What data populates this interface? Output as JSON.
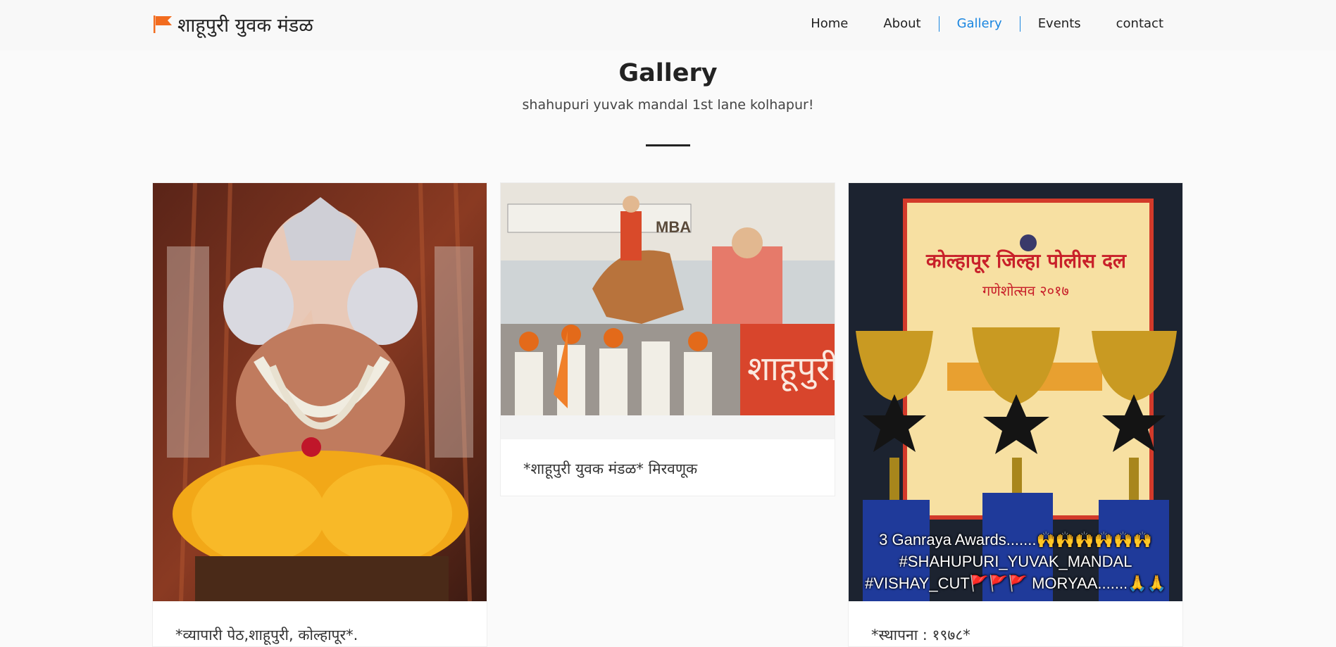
{
  "brand": {
    "title": "शाहूपुरी युवक मंडळ",
    "flag_color": "#f26c1f"
  },
  "nav": {
    "items": [
      {
        "label": "Home",
        "active": false
      },
      {
        "label": "About",
        "active": false
      },
      {
        "label": "Gallery",
        "active": true
      },
      {
        "label": "Events",
        "active": false
      },
      {
        "label": "contact",
        "active": false
      }
    ],
    "active_color": "#1a86e0"
  },
  "header": {
    "title": "Gallery",
    "subtitle": "shahupuri yuvak mandal 1st lane kolhapur!"
  },
  "gallery": {
    "cards": [
      {
        "caption": "*व्यापारी पेठ,शाहूपुरी, कोल्हापूर*.",
        "image": "ganesh-idol-photo"
      },
      {
        "caption": "*शाहूपुरी युवक मंडळ* मिरवणूक",
        "image": "procession-photo",
        "banner_text": "MBA"
      },
      {
        "caption": "*स्थापना : १९७८*",
        "image": "trophies-photo",
        "certificate_title": "कोल्हापूर जिल्हा पोलीस दल",
        "certificate_subtitle": "गणेशोत्सव २०१७",
        "overlay_lines": [
          "3 Ganraya Awards.......🙌🙌🙌🙌🙌🙌",
          "#SHAHUPURI_YUVAK_MANDAL",
          "#VISHAY_CUT🚩🚩🚩 MORYAA.......🙏🙏"
        ]
      }
    ]
  }
}
